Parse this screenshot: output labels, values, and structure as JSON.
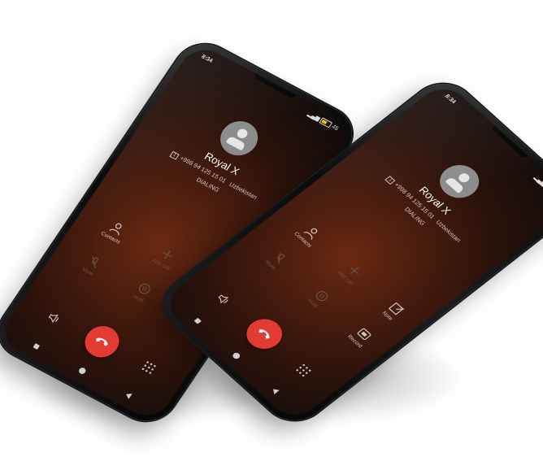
{
  "status_bar": {
    "time": "8:34",
    "battery_text": "45"
  },
  "contact": {
    "name": "Royal X",
    "sim_tag": "1",
    "number": "+998 94 125 15 01",
    "country": "Uzbekistan",
    "call_status": "DIALING"
  },
  "controls": {
    "contacts_label": "Contacts",
    "add_call_label": "Add call",
    "note_label": "Note",
    "mute_label": "Mute",
    "hold_label": "Hold",
    "record_label": "Record"
  },
  "colors": {
    "end_call": "#e23b34",
    "background_glow": "#6a2a12",
    "battery_fill": "#f5c400"
  }
}
